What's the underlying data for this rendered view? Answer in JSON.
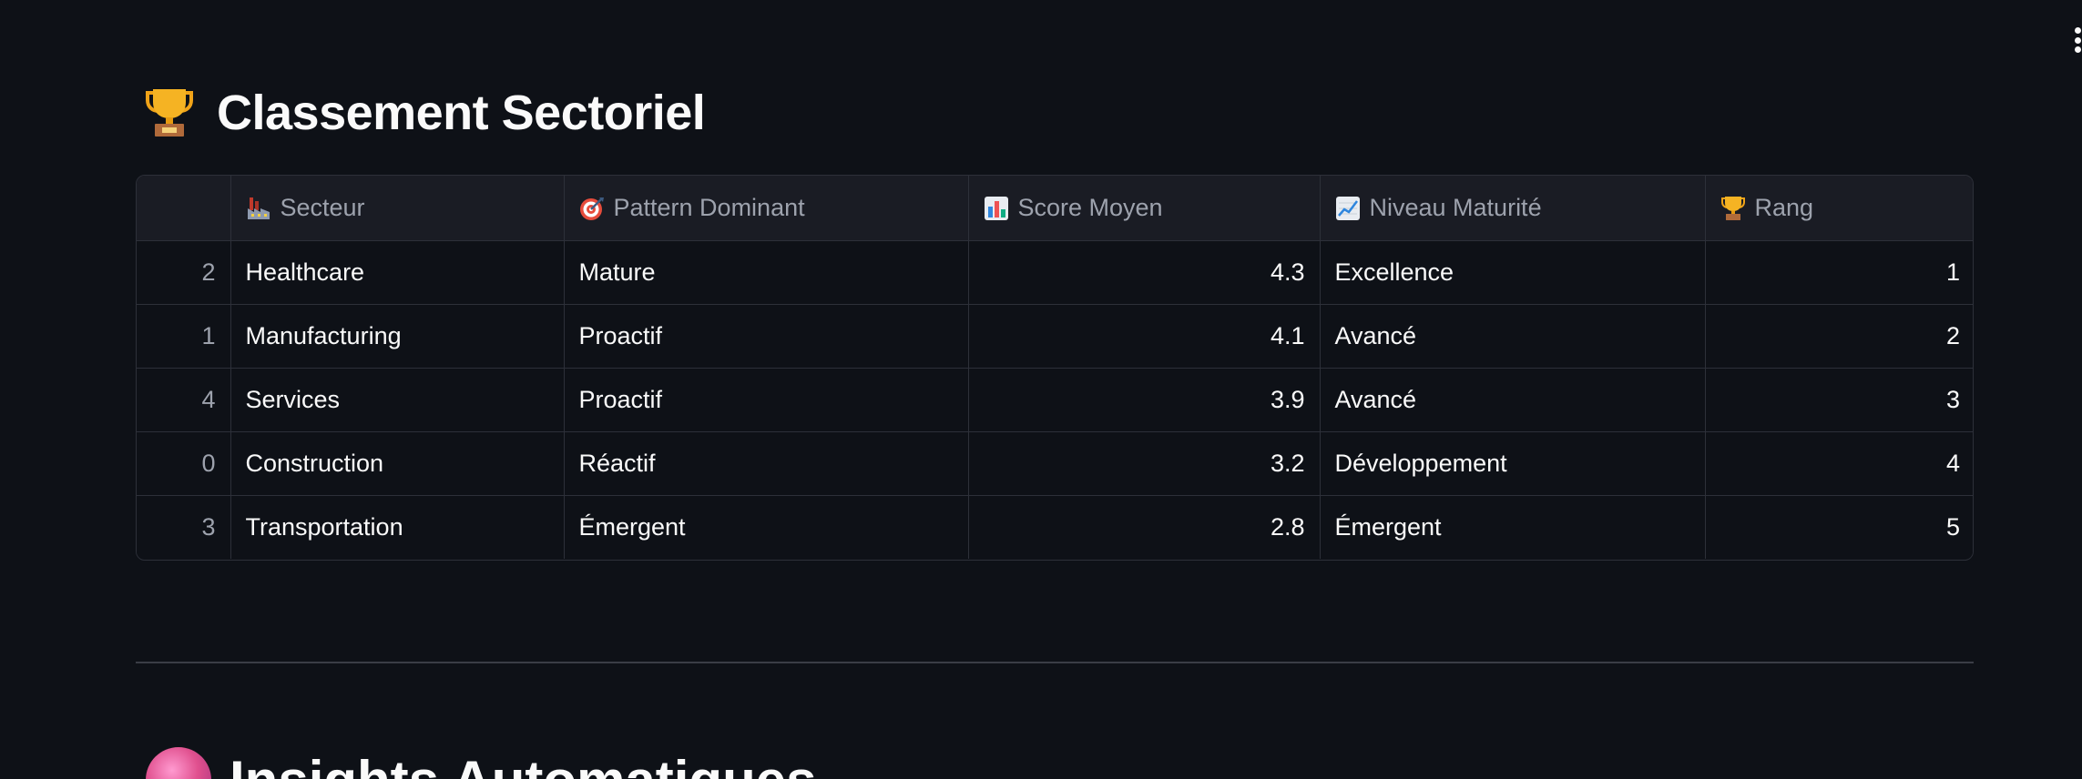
{
  "section": {
    "icon": "trophy-icon",
    "title": "Classement Sectoriel"
  },
  "table": {
    "columns": [
      {
        "icon": "factory-icon",
        "label": "Secteur"
      },
      {
        "icon": "target-icon",
        "label": "Pattern Dominant"
      },
      {
        "icon": "bar-chart-icon",
        "label": "Score Moyen"
      },
      {
        "icon": "trend-chart-icon",
        "label": "Niveau Maturité"
      },
      {
        "icon": "trophy-icon",
        "label": "Rang"
      }
    ],
    "rows": [
      {
        "index": "2",
        "secteur": "Healthcare",
        "pattern": "Mature",
        "score": "4.3",
        "maturite": "Excellence",
        "rang": "1"
      },
      {
        "index": "1",
        "secteur": "Manufacturing",
        "pattern": "Proactif",
        "score": "4.1",
        "maturite": "Avancé",
        "rang": "2"
      },
      {
        "index": "4",
        "secteur": "Services",
        "pattern": "Proactif",
        "score": "3.9",
        "maturite": "Avancé",
        "rang": "3"
      },
      {
        "index": "0",
        "secteur": "Construction",
        "pattern": "Réactif",
        "score": "3.2",
        "maturite": "Développement",
        "rang": "4"
      },
      {
        "index": "3",
        "secteur": "Transportation",
        "pattern": "Émergent",
        "score": "2.8",
        "maturite": "Émergent",
        "rang": "5"
      }
    ]
  },
  "next_section": {
    "icon": "crystal-ball-icon",
    "title": "Insights Automatiques"
  },
  "colors": {
    "background": "#0e1117",
    "header_bg": "#1a1c24",
    "border": "#2d3039",
    "text": "#fafafa",
    "muted": "#9da2ad"
  }
}
